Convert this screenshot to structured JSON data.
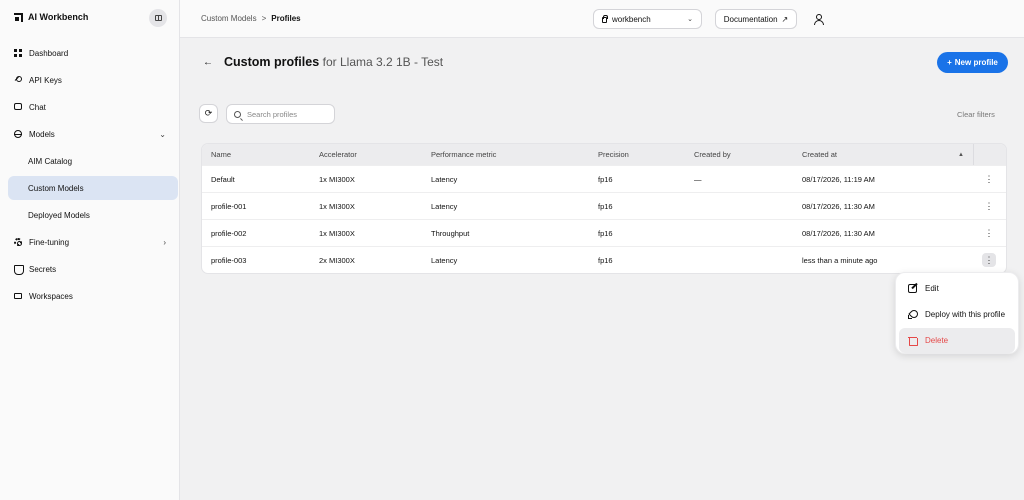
{
  "app": {
    "title": "AI Workbench"
  },
  "sidebar": {
    "items": [
      {
        "label": "Dashboard"
      },
      {
        "label": "API Keys"
      },
      {
        "label": "Chat"
      },
      {
        "label": "Models"
      },
      {
        "label": "AIM Catalog"
      },
      {
        "label": "Custom Models"
      },
      {
        "label": "Deployed Models"
      },
      {
        "label": "Fine-tuning"
      },
      {
        "label": "Secrets"
      },
      {
        "label": "Workspaces"
      }
    ]
  },
  "header": {
    "breadcrumb": [
      "Custom Models",
      "Profiles"
    ],
    "breadcrumb_sep": ">",
    "workspace": "workbench",
    "documentation": "Documentation"
  },
  "page": {
    "title": "Custom profiles",
    "subtitle": "for Llama 3.2 1B - Test",
    "new_button": "New profile"
  },
  "filters": {
    "search_placeholder": "Search profiles",
    "clear": "Clear filters"
  },
  "table": {
    "columns": [
      "Name",
      "Accelerator",
      "Performance metric",
      "Precision",
      "Created by",
      "Created at"
    ],
    "rows": [
      [
        "Default",
        "1x MI300X",
        "Latency",
        "fp16",
        "—",
        "08/17/2026, 11:19 AM"
      ],
      [
        "profile-001",
        "1x MI300X",
        "Latency",
        "fp16",
        "",
        "08/17/2026, 11:30 AM"
      ],
      [
        "profile-002",
        "1x MI300X",
        "Throughput",
        "fp16",
        "",
        "08/17/2026, 11:30 AM"
      ],
      [
        "profile-003",
        "2x MI300X",
        "Latency",
        "fp16",
        "",
        "less than a minute ago"
      ]
    ]
  },
  "menu": {
    "items": [
      {
        "label": "Edit"
      },
      {
        "label": "Deploy with this profile"
      },
      {
        "label": "Delete"
      }
    ]
  },
  "colors": {
    "accent": "#1a73e8",
    "danger": "#e54848",
    "active_nav": "#dbe4f3"
  }
}
